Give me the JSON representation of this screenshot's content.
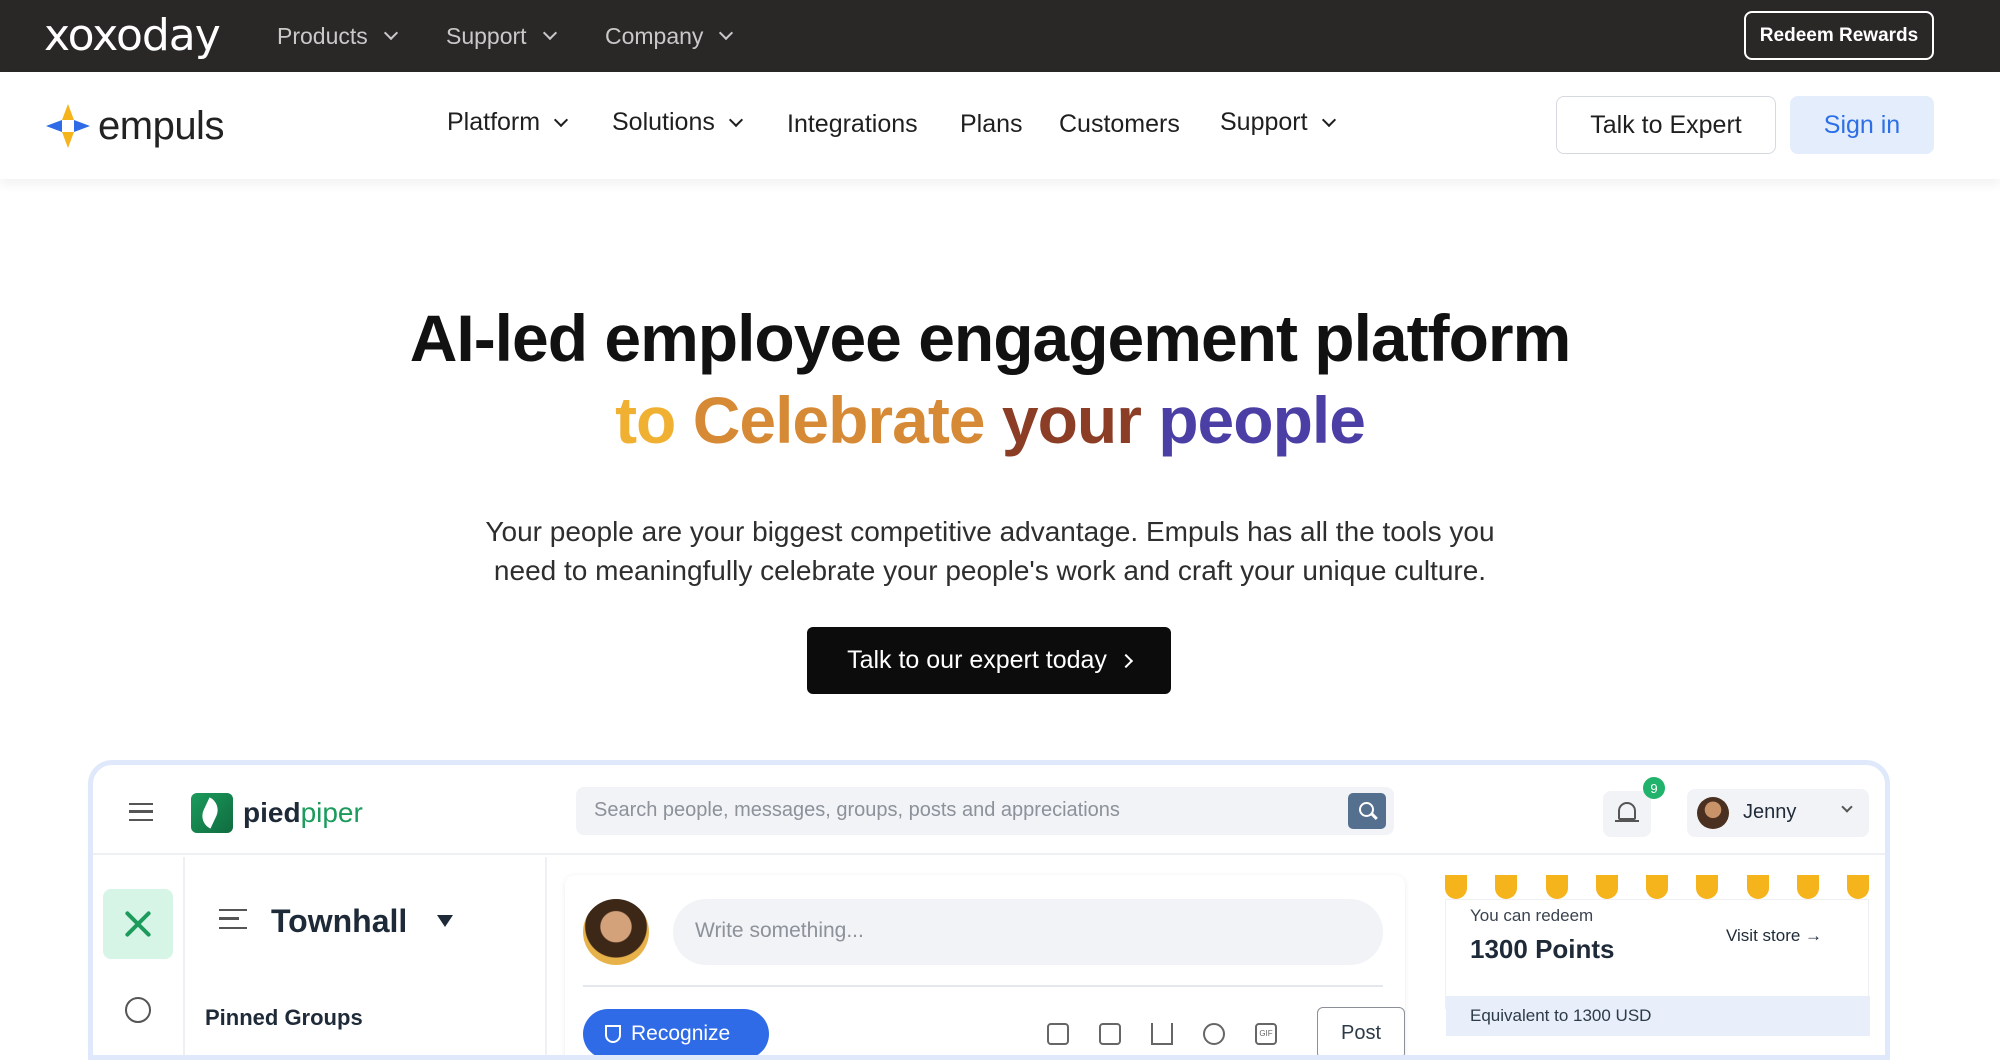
{
  "topbar": {
    "logo": "xoxoday",
    "nav": [
      "Products",
      "Support",
      "Company"
    ],
    "redeem_label": "Redeem Rewards"
  },
  "mainnav": {
    "logo": "empuls",
    "items": [
      {
        "label": "Platform",
        "dropdown": true
      },
      {
        "label": "Solutions",
        "dropdown": true
      },
      {
        "label": "Integrations",
        "dropdown": false
      },
      {
        "label": "Plans",
        "dropdown": false
      },
      {
        "label": "Customers",
        "dropdown": false
      },
      {
        "label": "Support",
        "dropdown": true
      }
    ],
    "talk_label": "Talk to Expert",
    "signin_label": "Sign in"
  },
  "hero": {
    "title_line1": "AI-led employee engagement platform",
    "title_line2_words": [
      "to",
      "Celebrate",
      "your",
      "people"
    ],
    "subtitle_line1": "Your people are your biggest competitive advantage. Empuls has all the tools you",
    "subtitle_line2": "need to meaningfully celebrate your people's work and craft your unique culture.",
    "cta_label": "Talk to our expert today"
  },
  "app": {
    "brand_left": "pied",
    "brand_right": "piper",
    "search_placeholder": "Search people, messages, groups, posts and appreciations",
    "notification_count": "9",
    "user_name": "Jenny",
    "group_title": "Townhall",
    "pinned_label": "Pinned Groups",
    "write_placeholder": "Write something...",
    "recognize_label": "Recognize",
    "tools": [
      "image-icon",
      "video-icon",
      "poll-icon",
      "emoji-icon",
      "gif-icon"
    ],
    "gif_label": "GIF",
    "post_label": "Post",
    "reward": {
      "label": "You can redeem",
      "points": "1300 Points",
      "store_label": "Visit store →",
      "equivalent": "Equivalent to 1300 USD"
    }
  },
  "colors": {
    "topbar_bg": "#2a2727",
    "accent_blue": "#2f6be6",
    "brand_green": "#1c9b5c",
    "reward_yellow": "#f5b31c"
  }
}
